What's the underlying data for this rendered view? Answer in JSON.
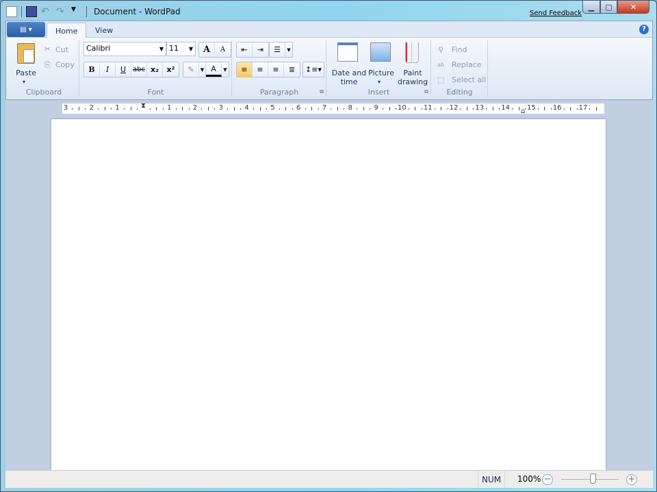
{
  "window": {
    "title": "Document - WordPad",
    "send_feedback": "Send Feedback",
    "minimize": "▁",
    "maximize": "▢",
    "close": "✕"
  },
  "quick_access": {
    "icons": [
      "wordpad-icon",
      "save-icon",
      "undo-icon",
      "redo-icon",
      "customize-dropdown-icon"
    ]
  },
  "ribbon": {
    "tabs": [
      {
        "label": "Home",
        "active": true
      },
      {
        "label": "View",
        "active": false
      }
    ],
    "help": "?",
    "clipboard": {
      "label": "Clipboard",
      "paste": "Paste",
      "cut": "Cut",
      "copy": "Copy"
    },
    "font": {
      "label": "Font",
      "family": "Calibri",
      "size": "11",
      "grow": "A",
      "shrink": "A",
      "bold": "B",
      "italic": "I",
      "underline": "U",
      "strike": "abc",
      "subscript": "x₂",
      "superscript": "x²",
      "text_color": "A"
    },
    "paragraph": {
      "label": "Paragraph"
    },
    "insert": {
      "label": "Insert",
      "date_time": "Date and time",
      "picture": "Picture",
      "paint": "Paint drawing"
    },
    "editing": {
      "label": "Editing",
      "find": "Find",
      "replace": "Replace",
      "select_all": "Select all"
    }
  },
  "ruler": {
    "labels": [
      "3",
      "2",
      "1",
      "",
      "1",
      "2",
      "3",
      "4",
      "5",
      "6",
      "7",
      "8",
      "9",
      "10",
      "11",
      "12",
      "13",
      "14",
      "15",
      "16",
      "17"
    ]
  },
  "status": {
    "num": "NUM",
    "zoom": "100%",
    "zoom_level_percent": 100
  }
}
